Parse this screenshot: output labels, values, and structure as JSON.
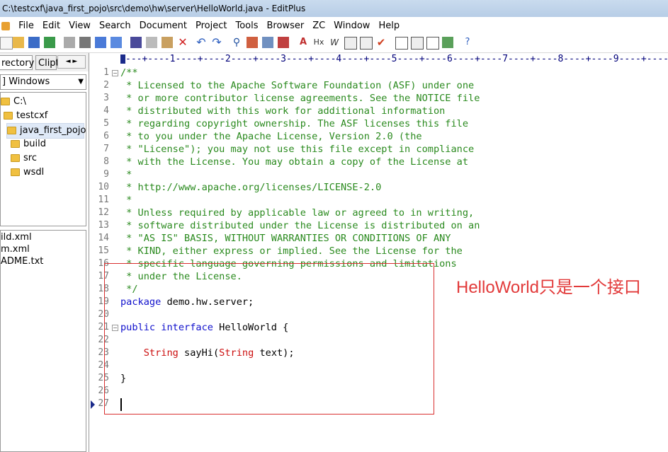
{
  "window": {
    "title": "C:\\testcxf\\java_first_pojo\\src\\demo\\hw\\server\\HelloWorld.java - EditPlus"
  },
  "menu": [
    "File",
    "Edit",
    "View",
    "Search",
    "Document",
    "Project",
    "Tools",
    "Browser",
    "ZC",
    "Window",
    "Help"
  ],
  "left_panel": {
    "tabs": [
      "rectory",
      "Clipt"
    ],
    "drive": "] Windows",
    "tree": [
      "C:\\",
      "testcxf",
      "java_first_pojo",
      "build",
      "src",
      "wsdl"
    ],
    "files": [
      "ild.xml",
      "m.xml",
      "ADME.txt"
    ]
  },
  "editor": {
    "ruler": "---+----1----+----2----+----3----+----4----+----5----+----6----+----7----+----8----+----9----+----",
    "lines": [
      {
        "n": "1",
        "text": "/**"
      },
      {
        "n": "2",
        "text": " * Licensed to the Apache Software Foundation (ASF) under one"
      },
      {
        "n": "3",
        "text": " * or more contributor license agreements. See the NOTICE file"
      },
      {
        "n": "4",
        "text": " * distributed with this work for additional information"
      },
      {
        "n": "5",
        "text": " * regarding copyright ownership. The ASF licenses this file"
      },
      {
        "n": "6",
        "text": " * to you under the Apache License, Version 2.0 (the"
      },
      {
        "n": "7",
        "text": " * \"License\"); you may not use this file except in compliance"
      },
      {
        "n": "8",
        "text": " * with the License. You may obtain a copy of the License at"
      },
      {
        "n": "9",
        "text": " *"
      },
      {
        "n": "10",
        "text": " * http://www.apache.org/licenses/LICENSE-2.0"
      },
      {
        "n": "11",
        "text": " *"
      },
      {
        "n": "12",
        "text": " * Unless required by applicable law or agreed to in writing,"
      },
      {
        "n": "13",
        "text": " * software distributed under the License is distributed on an"
      },
      {
        "n": "14",
        "text": " * \"AS IS\" BASIS, WITHOUT WARRANTIES OR CONDITIONS OF ANY"
      },
      {
        "n": "15",
        "text": " * KIND, either express or implied. See the License for the"
      },
      {
        "n": "16",
        "text": " * specific language governing permissions and limitations"
      },
      {
        "n": "17",
        "text": " * under the License."
      },
      {
        "n": "18",
        "text": " */"
      },
      {
        "n": "19",
        "kw": "package",
        "rest": " demo.hw.server;"
      },
      {
        "n": "20",
        "text": ""
      },
      {
        "n": "21",
        "kw": "public interface",
        "rest": " HelloWorld {"
      },
      {
        "n": "22",
        "text": ""
      },
      {
        "n": "23",
        "indent": "    ",
        "ty1": "String",
        "mid": " sayHi(",
        "ty2": "String",
        "end": " text);"
      },
      {
        "n": "24",
        "text": ""
      },
      {
        "n": "25",
        "plain": "}"
      },
      {
        "n": "26",
        "text": ""
      },
      {
        "n": "27",
        "text": ""
      }
    ]
  },
  "annotation": "HelloWorld只是一个接口",
  "colors": {
    "comment": "#2a8a1e",
    "keyword": "#1010cc",
    "type": "#cc1010",
    "annotation": "#e23a3a"
  }
}
